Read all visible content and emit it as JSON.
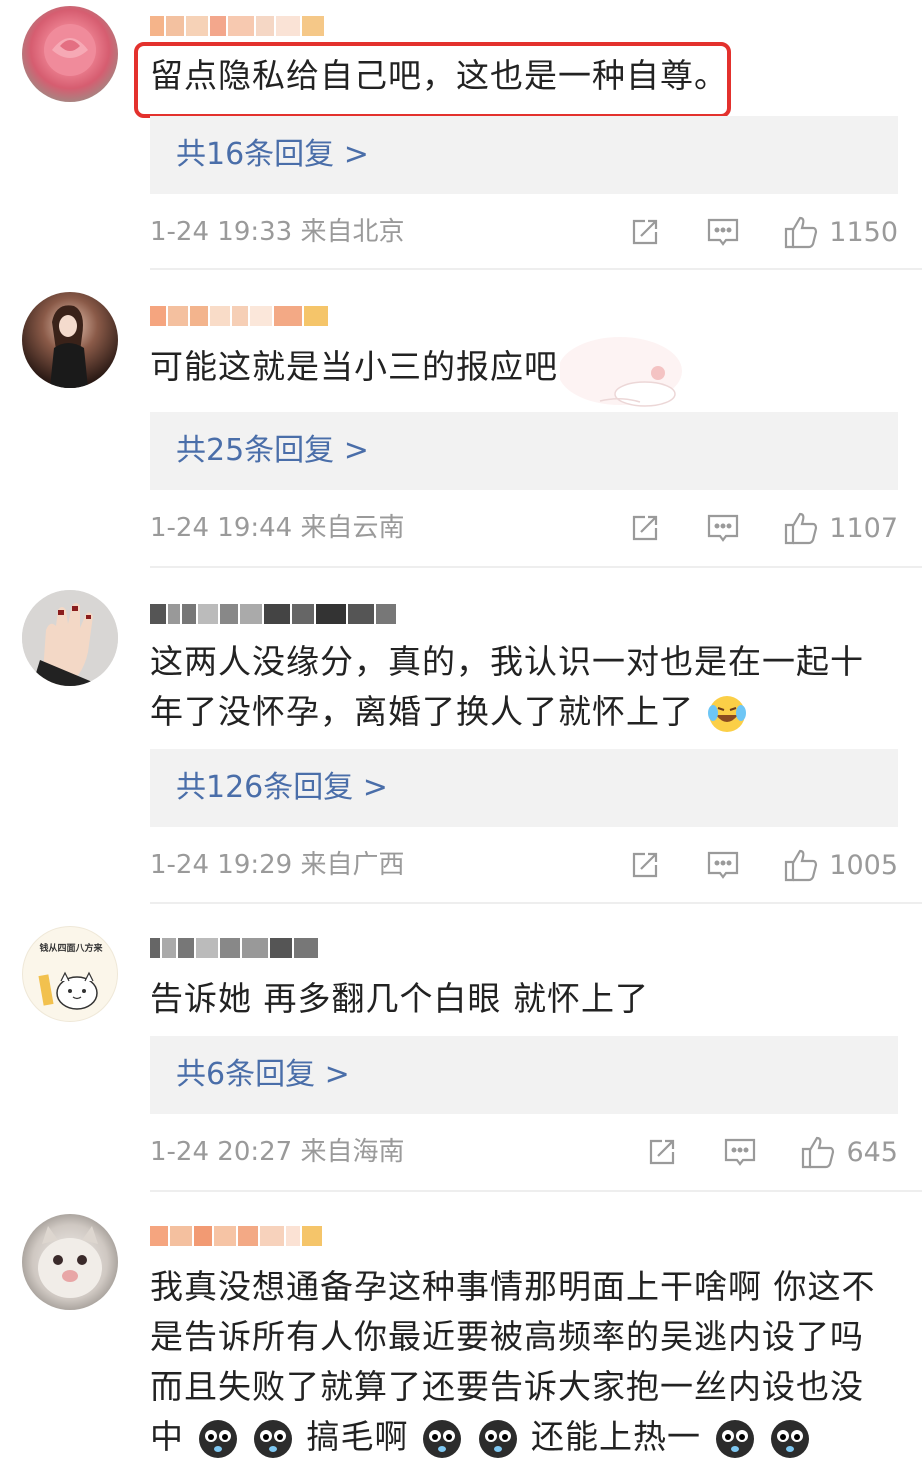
{
  "comments": [
    {
      "text_lines": [
        "留点隐私给自己吧，这也是一种自尊。"
      ],
      "replies_label": "共16条回复 >",
      "time": "1-24 19:33",
      "location": "来自北京",
      "likes": "1150",
      "highlighted": true
    },
    {
      "text_lines": [
        "可能这就是当小三的报应吧..."
      ],
      "replies_label": "共25条回复 >",
      "time": "1-24 19:44",
      "location": "来自云南",
      "likes": "1107"
    },
    {
      "text_lines": [
        "这两人没缘分，真的，我认识一对也是在一起十",
        "年了没怀孕，离婚了换人了就怀上了"
      ],
      "replies_label": "共126条回复 >",
      "time": "1-24 19:29",
      "location": "来自广西",
      "likes": "1005"
    },
    {
      "text_lines": [
        "告诉她 再多翻几个白眼 就怀上了"
      ],
      "replies_label": "共6条回复 >",
      "time": "1-24 20:27",
      "location": "来自海南",
      "likes": "645",
      "avatar_text": "钱从四面八方来"
    },
    {
      "text_lines": [
        "我真没想通备孕这种事情那明面上干啥啊 你这不",
        "是告诉所有人你最近要被高频率的吴逃内设了吗",
        "而且失败了就算了还要告诉大家抱一丝内设也没"
      ],
      "last_line_parts": [
        "中",
        "搞毛啊",
        "还能上热一"
      ]
    }
  ],
  "colors": {
    "highlight": "#e3312d",
    "reply_link": "#4a6ea9",
    "meta": "#9a9a9a",
    "reply_bg": "#f2f2f2"
  },
  "icons": [
    "share-icon",
    "comment-icon",
    "like-icon"
  ]
}
